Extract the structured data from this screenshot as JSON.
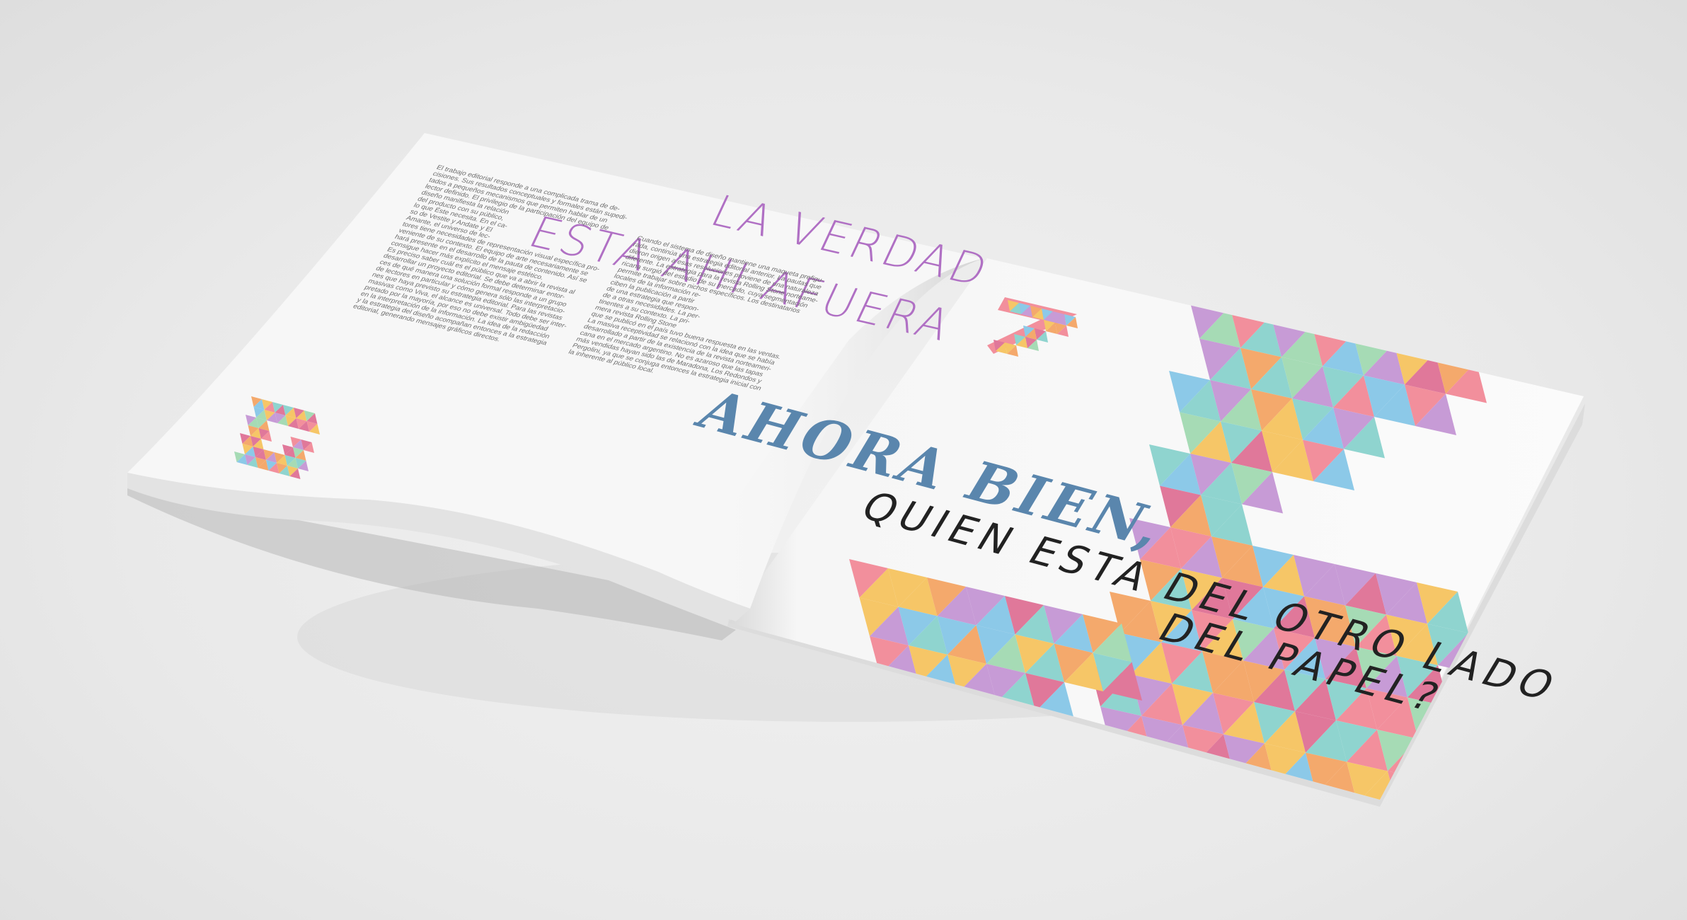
{
  "left_page": {
    "title_line1": "LA VERDAD",
    "title_line2": "ESTA AHI AFUERA",
    "page_number": "6",
    "body_column": "El trabajo editorial responde a una complicada trama de de-\ncisiones. Sus resultados conceptuales y formales están supedi-\ntados a pequeños mecanismos que permiten hablar de un\nlector definido. El privilegio de la participación del equipo de\ndiseño manifiesta la relación\ndel producto con su público,\nlo que Éste necesita. En el ca-\nso de Vestite y Andate y El\nAmante, el universo de lec-\ntores tiene necesidades de representación visual específica pro-\nveniente de su contexto. El equipo de arte necesariamente se\nhará presente en el desarrollo de la pauta de contenido. Así se\nconsigue hacer más explícito el mensaje estético.\nEs preciso saber cuál es el público que va a abrir la revista al\ndesarrollar un proyecto editorial. Se debe determinar entor-\nces de qué manera una solución formal responde a un grupo\nde lectores en particular y cómo genera sólo las interpretacio-\nnes que haya previsto su estrategia editorial. Para las revistas\nmasivas como Viva, el alcance es universal. Todo debe ser inter-\npretado por la mayoría, por eso no debe existir ambigüedad\nen la interpretación de la información. La idea de la redacción\ny la estrategia del diseño acompañan entonces a la estrategia\neditorial, generando mensajes gráficos directos.",
    "body_column2": "Cuando el sistema de diseño mantiene una maqueta prefigu-\nrada, continúa una estrategia editorial anterior. La pautas que\ndieron origen a esas resoluciones proviene de una naturaleza\ndiferente. La estrategia para la revista Rolling Stone norteame-\nricana surgió del estudio de su mercado, cuya segmentación\npermite trabajar sobre nichos específicos. Los destinatarios\nlocales de la información re-\nciben la publicación a partir\nde una estrategia que respon-\nde a otras necesidades. La per-\ntinentes a su contexto. La pri-\nmera revista Rolling Stone\nque se publicó en el país tuvo buena respuesta en las ventas.\nLa masiva receptividad se relacionó con la idea que se había\ndesarrollado a partir de la existencia de la revista norteameri-\ncana en el mercado argentino. No es azaroso que las tapas\nmás vendidas hayan sido las de Maradona, Los Redondos y\nPergolini, ya que se conjuga entonces la estrategia inicial con\nla inherente al público local."
  },
  "right_page": {
    "page_number": "7",
    "headline": "AHORA BIEN,",
    "subline1": "QUIEN ESTA DEL OTRO LADO",
    "subline2": "DEL PAPEL?"
  },
  "pattern_colors": [
    "#f28f9c",
    "#8fd4cf",
    "#f6c667",
    "#c79bd6",
    "#a6dbb5",
    "#f4a96c",
    "#e0789a",
    "#8cc9e8"
  ]
}
